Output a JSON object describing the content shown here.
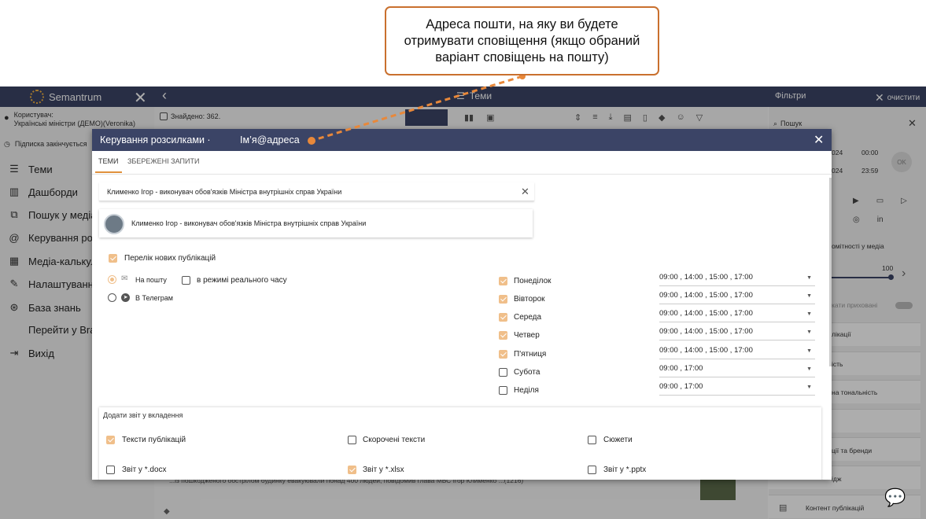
{
  "callout": {
    "text": "Адреса пошти, на яку ви будете\nотримувати сповіщення (якщо обраний\nваріант сповіщень на пошту)"
  },
  "topbar": {
    "brand": "Semantrum",
    "section": "Теми",
    "filters": "Фільтри",
    "clear": "очистити"
  },
  "sidebar": {
    "user_label": "Користувач:",
    "user_name": "Українські міністри (ДЕМО)(Veronika)",
    "subscription": "Підписка закінчується",
    "items": [
      {
        "label": "Теми",
        "icon": "list-icon"
      },
      {
        "label": "Дашборди",
        "icon": "chart-icon"
      },
      {
        "label": "Пошук у медіа",
        "icon": "external-link-icon"
      },
      {
        "label": "Керування розсилками",
        "icon": "at-icon"
      },
      {
        "label": "Медіа-калькулятор",
        "icon": "grid-icon"
      },
      {
        "label": "Налаштування",
        "icon": "wrench-icon"
      },
      {
        "label": "База знань",
        "icon": "lifebuoy-icon"
      },
      {
        "label": "Перейти у Brand",
        "icon": ""
      },
      {
        "label": "Вихід",
        "icon": "logout-icon"
      }
    ]
  },
  "main": {
    "found": "Знайдено: 362.",
    "snippet": "...із пошкодженого обстрілом будинку евакуювали понад 400 людей, повідомив глава МВС Ігор Клименко ...(1216)"
  },
  "right_panel": {
    "search_placeholder": "Пошук",
    "date1": "024",
    "time1": "00:00",
    "date2": "024",
    "time2": "23:59",
    "ok": "OK",
    "sections": [
      "омітності у медіа",
      "100",
      "кати приховані",
      "лікації",
      "ість",
      "на тональність",
      "ції та бренди",
      "ідж",
      "Контент публікацій"
    ]
  },
  "modal": {
    "title": "Керування розсилками ·",
    "email": "Ім’я@адреса",
    "tabs": [
      "ТЕМИ",
      "ЗБЕРЕЖЕНІ ЗАПИТИ"
    ],
    "search_value": "Клименко Ігор - виконувач обов'язків Міністра внутрішніх справ України",
    "result": "Клименко Ігор - виконувач обов'язків Міністра внутрішніх справ України",
    "new_publications": "Перелік нових публікацій",
    "channel_email": "На пошту",
    "realtime": "в режимі реального часу",
    "channel_telegram": "В Телеграм",
    "days": [
      {
        "name": "Понеділок",
        "checked": true,
        "times": "09:00 , 14:00 , 15:00 , 17:00"
      },
      {
        "name": "Вівторок",
        "checked": true,
        "times": "09:00 , 14:00 , 15:00 , 17:00"
      },
      {
        "name": "Середа",
        "checked": true,
        "times": "09:00 , 14:00 , 15:00 , 17:00"
      },
      {
        "name": "Четвер",
        "checked": true,
        "times": "09:00 , 14:00 , 15:00 , 17:00"
      },
      {
        "name": "П'ятниця",
        "checked": true,
        "times": "09:00 , 14:00 , 15:00 , 17:00"
      },
      {
        "name": "Субота",
        "checked": false,
        "times": "09:00 , 17:00"
      },
      {
        "name": "Неділя",
        "checked": false,
        "times": "09:00 , 17:00"
      }
    ],
    "report_title": "Додати звіт у вкладення",
    "report_options": [
      {
        "label": "Тексти публікацій",
        "checked": true
      },
      {
        "label": "Скорочені тексти",
        "checked": false
      },
      {
        "label": "Сюжети",
        "checked": false
      },
      {
        "label": "Звіт у *.docx",
        "checked": false
      },
      {
        "label": "Звіт у *.xlsx",
        "checked": true
      },
      {
        "label": "Звіт у *.pptx",
        "checked": false
      }
    ]
  },
  "colors": {
    "header": "#3b4466",
    "accent": "#f0bf8a",
    "callout_border": "#c9702e"
  }
}
